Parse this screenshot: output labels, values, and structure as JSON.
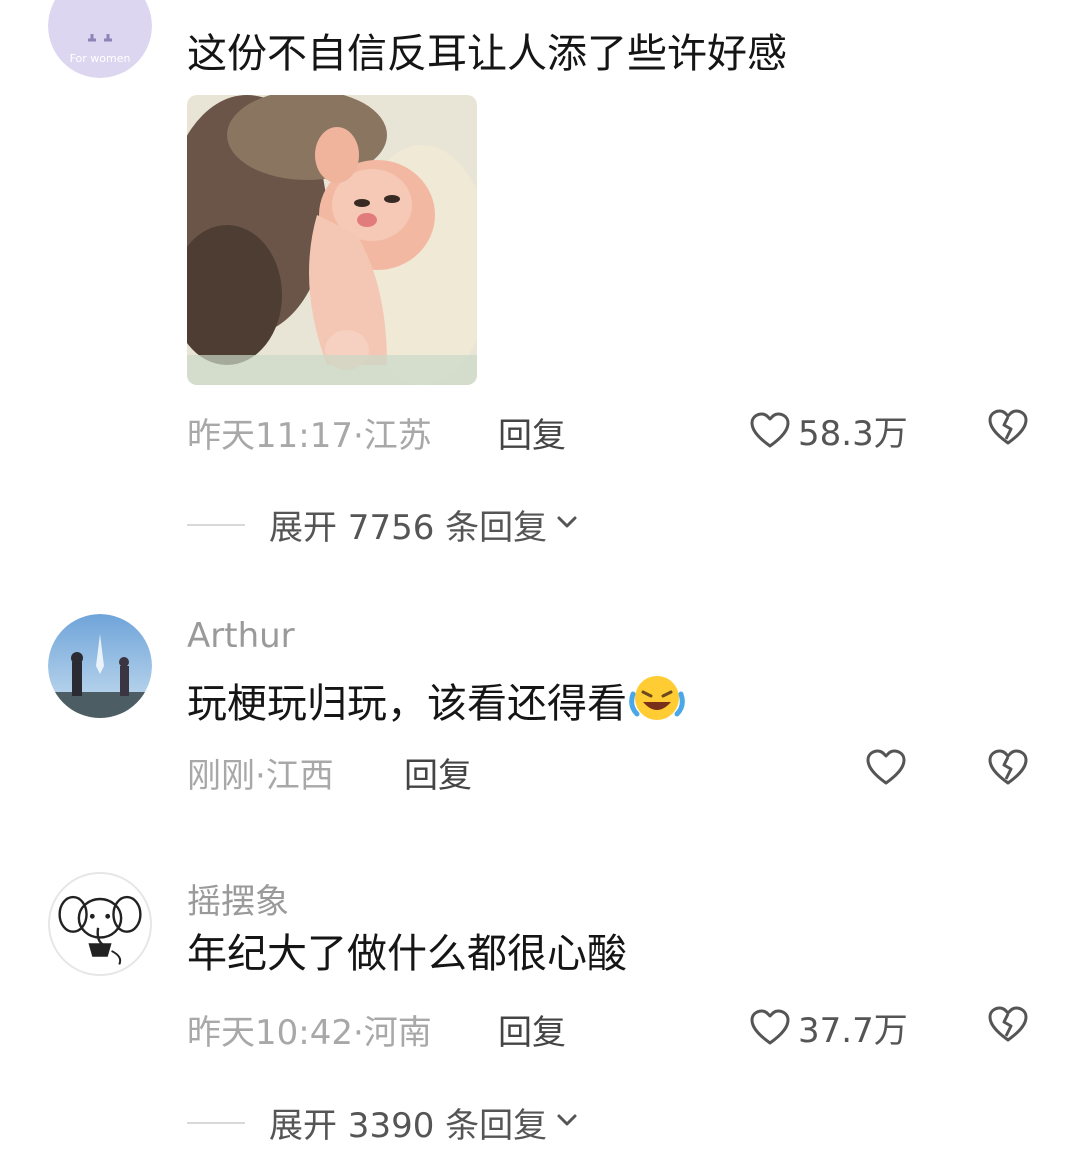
{
  "comments": [
    {
      "avatar_label": "For women",
      "text": "这份不自信反耳让人添了些许好感",
      "meta": "昨天11:17·江苏",
      "reply_label": "回复",
      "likes": "58.3万",
      "expand": "展开 7756 条回复"
    },
    {
      "username": "Arthur",
      "text": "玩梗玩归玩，该看还得看",
      "emoji": "laughing-crying-emoji",
      "meta": "刚刚·江西",
      "reply_label": "回复",
      "likes": ""
    },
    {
      "username": "摇摆象",
      "text": "年纪大了做什么都很心酸",
      "meta": "昨天10:42·河南",
      "reply_label": "回复",
      "likes": "37.7万",
      "expand": "展开 3390 条回复"
    }
  ],
  "icons": {
    "like": "heart-outline-icon",
    "dislike": "broken-heart-icon",
    "expand": "chevron-down-icon"
  },
  "colors": {
    "meta_text": "#a8a8a8",
    "avatar_lavender": "#ddd6f1"
  }
}
